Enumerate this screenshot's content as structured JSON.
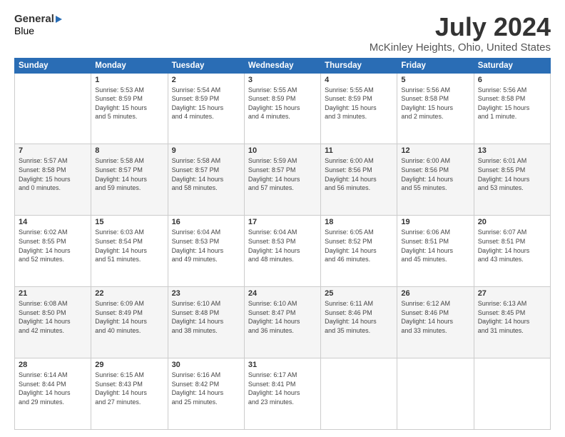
{
  "header": {
    "logo_general": "General",
    "logo_blue": "Blue",
    "title": "July 2024",
    "location": "McKinley Heights, Ohio, United States"
  },
  "weekdays": [
    "Sunday",
    "Monday",
    "Tuesday",
    "Wednesday",
    "Thursday",
    "Friday",
    "Saturday"
  ],
  "weeks": [
    [
      {
        "day": "",
        "info": ""
      },
      {
        "day": "1",
        "info": "Sunrise: 5:53 AM\nSunset: 8:59 PM\nDaylight: 15 hours\nand 5 minutes."
      },
      {
        "day": "2",
        "info": "Sunrise: 5:54 AM\nSunset: 8:59 PM\nDaylight: 15 hours\nand 4 minutes."
      },
      {
        "day": "3",
        "info": "Sunrise: 5:55 AM\nSunset: 8:59 PM\nDaylight: 15 hours\nand 4 minutes."
      },
      {
        "day": "4",
        "info": "Sunrise: 5:55 AM\nSunset: 8:59 PM\nDaylight: 15 hours\nand 3 minutes."
      },
      {
        "day": "5",
        "info": "Sunrise: 5:56 AM\nSunset: 8:58 PM\nDaylight: 15 hours\nand 2 minutes."
      },
      {
        "day": "6",
        "info": "Sunrise: 5:56 AM\nSunset: 8:58 PM\nDaylight: 15 hours\nand 1 minute."
      }
    ],
    [
      {
        "day": "7",
        "info": "Sunrise: 5:57 AM\nSunset: 8:58 PM\nDaylight: 15 hours\nand 0 minutes."
      },
      {
        "day": "8",
        "info": "Sunrise: 5:58 AM\nSunset: 8:57 PM\nDaylight: 14 hours\nand 59 minutes."
      },
      {
        "day": "9",
        "info": "Sunrise: 5:58 AM\nSunset: 8:57 PM\nDaylight: 14 hours\nand 58 minutes."
      },
      {
        "day": "10",
        "info": "Sunrise: 5:59 AM\nSunset: 8:57 PM\nDaylight: 14 hours\nand 57 minutes."
      },
      {
        "day": "11",
        "info": "Sunrise: 6:00 AM\nSunset: 8:56 PM\nDaylight: 14 hours\nand 56 minutes."
      },
      {
        "day": "12",
        "info": "Sunrise: 6:00 AM\nSunset: 8:56 PM\nDaylight: 14 hours\nand 55 minutes."
      },
      {
        "day": "13",
        "info": "Sunrise: 6:01 AM\nSunset: 8:55 PM\nDaylight: 14 hours\nand 53 minutes."
      }
    ],
    [
      {
        "day": "14",
        "info": "Sunrise: 6:02 AM\nSunset: 8:55 PM\nDaylight: 14 hours\nand 52 minutes."
      },
      {
        "day": "15",
        "info": "Sunrise: 6:03 AM\nSunset: 8:54 PM\nDaylight: 14 hours\nand 51 minutes."
      },
      {
        "day": "16",
        "info": "Sunrise: 6:04 AM\nSunset: 8:53 PM\nDaylight: 14 hours\nand 49 minutes."
      },
      {
        "day": "17",
        "info": "Sunrise: 6:04 AM\nSunset: 8:53 PM\nDaylight: 14 hours\nand 48 minutes."
      },
      {
        "day": "18",
        "info": "Sunrise: 6:05 AM\nSunset: 8:52 PM\nDaylight: 14 hours\nand 46 minutes."
      },
      {
        "day": "19",
        "info": "Sunrise: 6:06 AM\nSunset: 8:51 PM\nDaylight: 14 hours\nand 45 minutes."
      },
      {
        "day": "20",
        "info": "Sunrise: 6:07 AM\nSunset: 8:51 PM\nDaylight: 14 hours\nand 43 minutes."
      }
    ],
    [
      {
        "day": "21",
        "info": "Sunrise: 6:08 AM\nSunset: 8:50 PM\nDaylight: 14 hours\nand 42 minutes."
      },
      {
        "day": "22",
        "info": "Sunrise: 6:09 AM\nSunset: 8:49 PM\nDaylight: 14 hours\nand 40 minutes."
      },
      {
        "day": "23",
        "info": "Sunrise: 6:10 AM\nSunset: 8:48 PM\nDaylight: 14 hours\nand 38 minutes."
      },
      {
        "day": "24",
        "info": "Sunrise: 6:10 AM\nSunset: 8:47 PM\nDaylight: 14 hours\nand 36 minutes."
      },
      {
        "day": "25",
        "info": "Sunrise: 6:11 AM\nSunset: 8:46 PM\nDaylight: 14 hours\nand 35 minutes."
      },
      {
        "day": "26",
        "info": "Sunrise: 6:12 AM\nSunset: 8:46 PM\nDaylight: 14 hours\nand 33 minutes."
      },
      {
        "day": "27",
        "info": "Sunrise: 6:13 AM\nSunset: 8:45 PM\nDaylight: 14 hours\nand 31 minutes."
      }
    ],
    [
      {
        "day": "28",
        "info": "Sunrise: 6:14 AM\nSunset: 8:44 PM\nDaylight: 14 hours\nand 29 minutes."
      },
      {
        "day": "29",
        "info": "Sunrise: 6:15 AM\nSunset: 8:43 PM\nDaylight: 14 hours\nand 27 minutes."
      },
      {
        "day": "30",
        "info": "Sunrise: 6:16 AM\nSunset: 8:42 PM\nDaylight: 14 hours\nand 25 minutes."
      },
      {
        "day": "31",
        "info": "Sunrise: 6:17 AM\nSunset: 8:41 PM\nDaylight: 14 hours\nand 23 minutes."
      },
      {
        "day": "",
        "info": ""
      },
      {
        "day": "",
        "info": ""
      },
      {
        "day": "",
        "info": ""
      }
    ]
  ]
}
